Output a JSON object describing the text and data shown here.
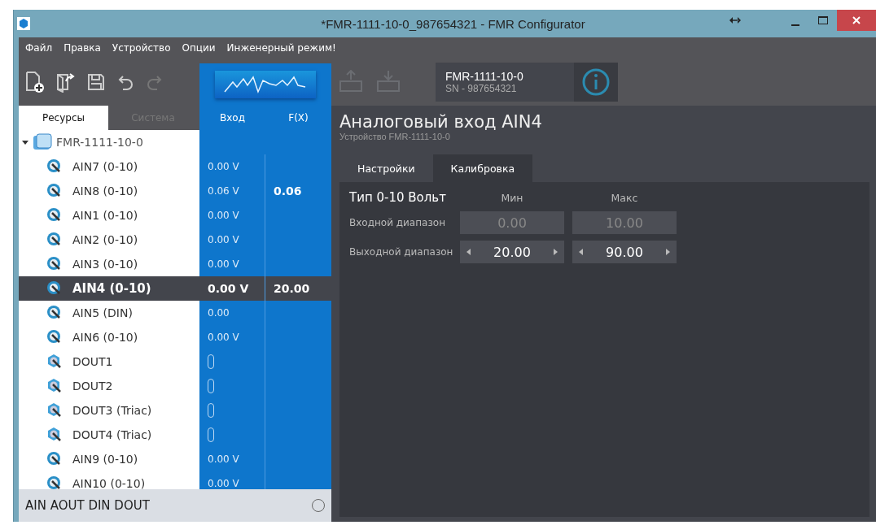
{
  "window": {
    "title": "*FMR-1111-10-0_987654321 - FMR Configurator"
  },
  "menu": [
    "Файл",
    "Правка",
    "Устройство",
    "Опции",
    "Инженерный режим!"
  ],
  "left_tabs": [
    {
      "label": "Ресурсы",
      "selected": true
    },
    {
      "label": "Система",
      "selected": false
    }
  ],
  "columns": [
    "Вход",
    "F(X)"
  ],
  "tree": {
    "label": "FMR-1111-10-0",
    "expanded": true,
    "children": [
      {
        "kind": "ain",
        "name": "AIN7 (0-10)",
        "input": "0.00 V",
        "selected": false
      },
      {
        "kind": "ain",
        "name": "AIN8 (0-10)",
        "input": "0.06 V",
        "fx": "0.06",
        "selected": false
      },
      {
        "kind": "ain",
        "name": "AIN1 (0-10)",
        "input": "0.00 V",
        "selected": false
      },
      {
        "kind": "ain",
        "name": "AIN2 (0-10)",
        "input": "0.00 V",
        "selected": false
      },
      {
        "kind": "ain",
        "name": "AIN3 (0-10)",
        "input": "0.00 V",
        "selected": false
      },
      {
        "kind": "ain",
        "name": "AIN4 (0-10)",
        "input": "0.00 V",
        "fx": "20.00",
        "selected": true
      },
      {
        "kind": "ain",
        "name": "AIN5 (DIN)",
        "input": "0.00",
        "selected": false
      },
      {
        "kind": "ain",
        "name": "AIN6 (0-10)",
        "input": "0.00 V",
        "selected": false
      },
      {
        "kind": "dout",
        "name": "DOUT1",
        "on": false,
        "selected": false
      },
      {
        "kind": "dout",
        "name": "DOUT2",
        "on": false,
        "selected": false
      },
      {
        "kind": "dout",
        "name": "DOUT3 (Triac)",
        "on": false,
        "selected": false
      },
      {
        "kind": "dout",
        "name": "DOUT4 (Triac)",
        "on": false,
        "selected": false
      },
      {
        "kind": "ain",
        "name": "AIN9 (0-10)",
        "input": "0.00 V",
        "selected": false
      },
      {
        "kind": "ain",
        "name": "AIN10 (0-10)",
        "input": "0.00 V",
        "selected": false
      }
    ]
  },
  "filter_bar": {
    "label": "AIN AOUT DIN DOUT",
    "checked": false
  },
  "device": {
    "name": "FMR-1111-10-0",
    "serial": "SN - 987654321"
  },
  "panel": {
    "title": "Аналоговый вход AIN4",
    "subtitle": "Устройство FMR-1111-10-0",
    "tabs": [
      {
        "label": "Настройки",
        "selected": false
      },
      {
        "label": "Калибровка",
        "selected": true
      }
    ],
    "type_label": "Тип 0-10 Вольт",
    "min_label": "Мин",
    "max_label": "Макс",
    "rows": [
      {
        "label": "Входной диапазон",
        "kind": "readonly",
        "min": "0.00",
        "max": "10.00"
      },
      {
        "label": "Выходной диапазон",
        "kind": "spinner",
        "min": "20.00",
        "max": "90.00"
      }
    ]
  }
}
